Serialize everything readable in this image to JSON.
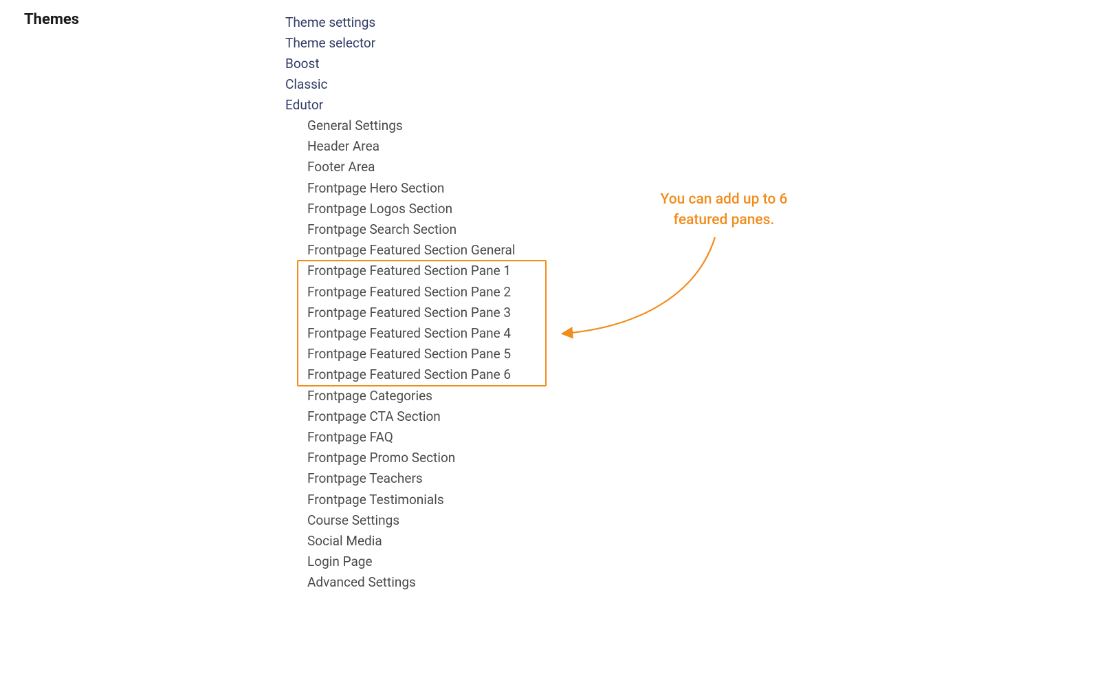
{
  "heading": "Themes",
  "links": {
    "theme_settings": "Theme settings",
    "theme_selector": "Theme selector",
    "boost": "Boost",
    "classic": "Classic",
    "edutor": "Edutor"
  },
  "sub_items": {
    "general_settings": "General Settings",
    "header_area": "Header Area",
    "footer_area": "Footer Area",
    "frontpage_hero": "Frontpage Hero Section",
    "frontpage_logos": "Frontpage Logos Section",
    "frontpage_search": "Frontpage Search Section",
    "frontpage_featured_general": "Frontpage Featured Section General",
    "frontpage_featured_pane_1": "Frontpage Featured Section Pane 1",
    "frontpage_featured_pane_2": "Frontpage Featured Section Pane 2",
    "frontpage_featured_pane_3": "Frontpage Featured Section Pane 3",
    "frontpage_featured_pane_4": "Frontpage Featured Section Pane 4",
    "frontpage_featured_pane_5": "Frontpage Featured Section Pane 5",
    "frontpage_featured_pane_6": "Frontpage Featured Section Pane 6",
    "frontpage_categories": "Frontpage Categories",
    "frontpage_cta": "Frontpage CTA Section",
    "frontpage_faq": "Frontpage FAQ",
    "frontpage_promo": "Frontpage Promo Section",
    "frontpage_teachers": "Frontpage Teachers",
    "frontpage_testimonials": "Frontpage Testimonials",
    "course_settings": "Course Settings",
    "social_media": "Social Media",
    "login_page": "Login Page",
    "advanced_settings": "Advanced Settings"
  },
  "annotation": {
    "line1": "You can add up to 6",
    "line2": "featured panes."
  },
  "colors": {
    "accent_orange": "#f28c1a",
    "link_blue": "#2f3a66"
  }
}
